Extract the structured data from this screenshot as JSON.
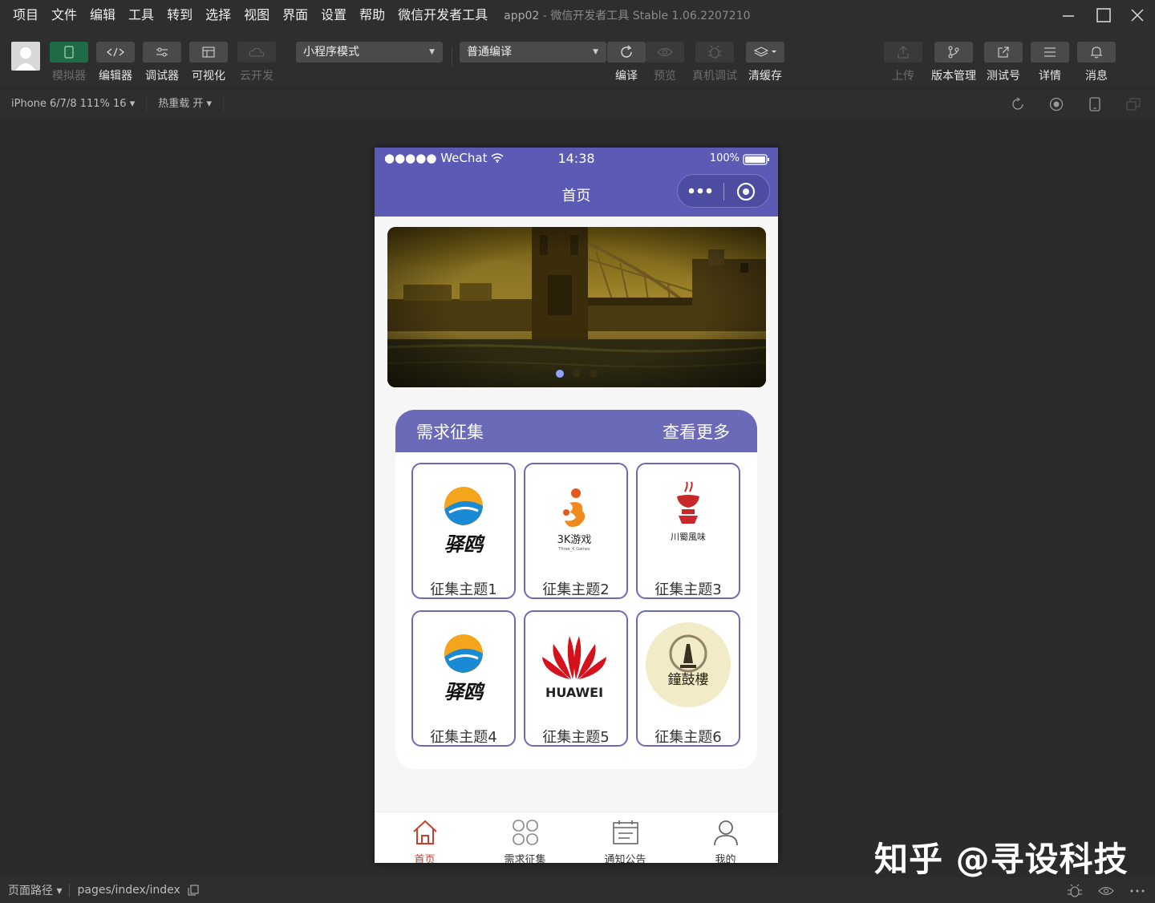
{
  "menu": [
    "项目",
    "文件",
    "编辑",
    "工具",
    "转到",
    "选择",
    "视图",
    "界面",
    "设置",
    "帮助",
    "微信开发者工具"
  ],
  "app_title": {
    "name": "app02",
    "sep": "-",
    "product": "微信开发者工具 Stable 1.06.2207210"
  },
  "toolbar": {
    "simulator": "模拟器",
    "editor": "编辑器",
    "debugger": "调试器",
    "visual": "可视化",
    "cloud": "云开发",
    "mode_select": "小程序模式",
    "compile_select": "普通编译",
    "compile": "编译",
    "preview": "预览",
    "remote_debug": "真机调试",
    "clear_cache": "清缓存",
    "upload": "上传",
    "version": "版本管理",
    "test_account": "测试号",
    "details": "详情",
    "messages": "消息"
  },
  "subbar": {
    "device": "iPhone 6/7/8 111% 16 ▾",
    "hot_reload": "热重载 开 ▾"
  },
  "phone": {
    "status": {
      "signal": "●●●●● WeChat",
      "time": "14:38",
      "battery": "100%"
    },
    "nav_title": "首页",
    "section": {
      "title": "需求征集",
      "more": "查看更多"
    },
    "tiles": [
      "征集主题1",
      "征集主题2",
      "征集主题3",
      "征集主题4",
      "征集主题5",
      "征集主题6"
    ],
    "logos": {
      "yiou": "驿鸥",
      "games": "3K游戏",
      "games_sub": "Three_K Games",
      "chuanshu": "川蜀風味",
      "huawei": "HUAWEI",
      "zhonggu": "鐘鼓樓"
    },
    "tabs": [
      "首页",
      "需求征集",
      "通知公告",
      "我的"
    ],
    "accent": "#5b5bb5",
    "active_tab": "#c8402c"
  },
  "bottombar": {
    "path_label": "页面路径 ▾",
    "path": "pages/index/index"
  },
  "watermark": "知乎 @寻设科技"
}
